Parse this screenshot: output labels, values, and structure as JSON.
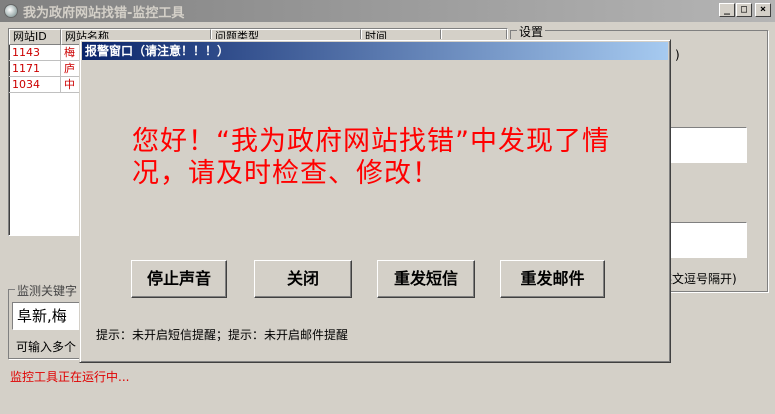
{
  "window": {
    "title": "我为政府网站找错-监控工具",
    "minimize_glyph": "_",
    "maximize_glyph": "□",
    "close_glyph": "×"
  },
  "list": {
    "columns": [
      "网站ID",
      "网站名称",
      "问题类型",
      "时间",
      ""
    ],
    "rows": [
      {
        "id": "1143",
        "name": "梅"
      },
      {
        "id": "1171",
        "name": "庐"
      },
      {
        "id": "1034",
        "name": "中"
      }
    ]
  },
  "settings": {
    "legend": "设置",
    "paren": ")",
    "note": "英文逗号隔开)"
  },
  "keywords": {
    "legend": "监测关键字",
    "value": "阜新,梅",
    "hint": "可输入多个"
  },
  "status": {
    "text": "监控工具正在运行中...",
    "color": "#e00000"
  },
  "dialog": {
    "title": "报警窗口（请注意！！！）",
    "message": "您好！“我为政府网站找错”中发现了情况，请及时检查、修改！",
    "message_color": "#ff0000",
    "buttons": {
      "stop_sound": "停止声音",
      "close": "关闭",
      "resend_sms": "重发短信",
      "resend_email": "重发邮件"
    },
    "tip": "提示：未开启短信提醒；提示：未开启邮件提醒"
  }
}
